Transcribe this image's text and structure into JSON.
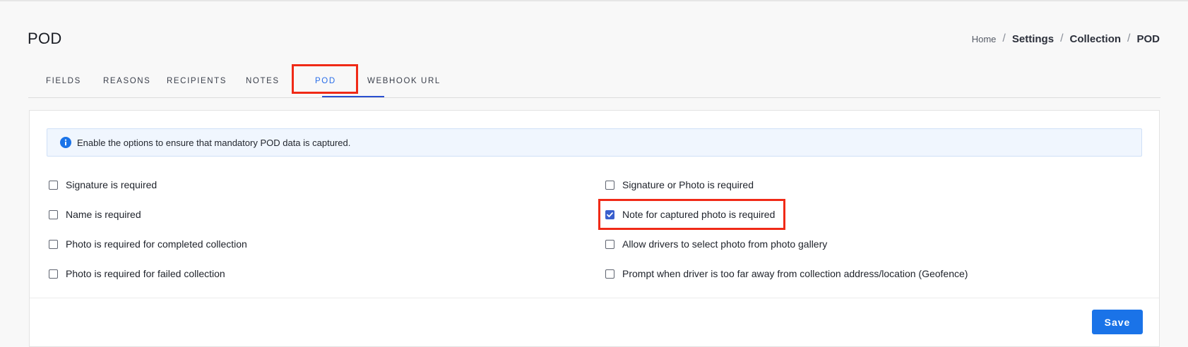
{
  "header": {
    "title": "POD"
  },
  "breadcrumb": {
    "home": "Home",
    "settings": "Settings",
    "collection": "Collection",
    "current": "POD",
    "separator": "/"
  },
  "tabs": [
    {
      "label": "FIELDS",
      "active": false
    },
    {
      "label": "REASONS",
      "active": false
    },
    {
      "label": "RECIPIENTS",
      "active": false
    },
    {
      "label": "NOTES",
      "active": false
    },
    {
      "label": "POD",
      "active": true
    },
    {
      "label": "WEBHOOK URL",
      "active": false
    }
  ],
  "info_banner": {
    "icon": "info-icon",
    "text": "Enable the options to ensure that mandatory POD data is captured."
  },
  "options": {
    "left": [
      {
        "label": "Signature is required",
        "checked": false
      },
      {
        "label": "Name is required",
        "checked": false
      },
      {
        "label": "Photo is required for completed collection",
        "checked": false
      },
      {
        "label": "Photo is required for failed collection",
        "checked": false
      }
    ],
    "right": [
      {
        "label": "Signature or Photo is required",
        "checked": false
      },
      {
        "label": "Note for captured photo is required",
        "checked": true
      },
      {
        "label": "Allow drivers to select photo from photo gallery",
        "checked": false
      },
      {
        "label": "Prompt when driver is too far away from collection address/location (Geofence)",
        "checked": false
      }
    ]
  },
  "actions": {
    "save_label": "Save"
  },
  "colors": {
    "accent": "#1a73e8",
    "active_tab": "#2a6ee8",
    "checkbox_checked": "#3a5fcd",
    "highlight": "#f02a17",
    "banner_bg": "#f0f6fe"
  }
}
